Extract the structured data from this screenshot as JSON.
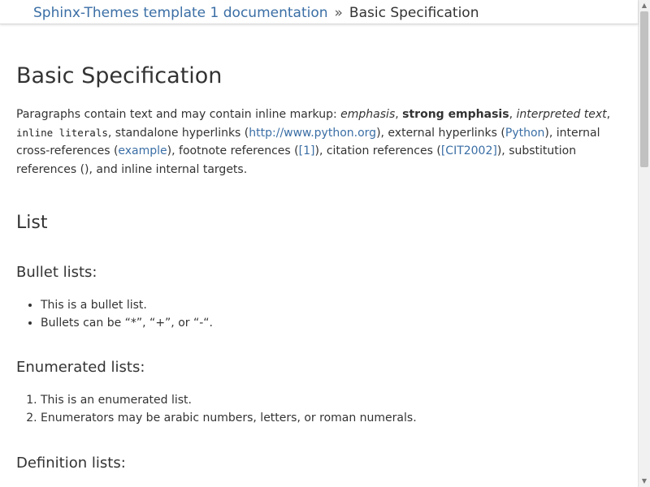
{
  "breadcrumb": {
    "home": "Sphinx-Themes template 1 documentation",
    "separator": "»",
    "current": "Basic Specification"
  },
  "page": {
    "title": "Basic Specification",
    "para": {
      "t1": "Paragraphs contain text and may contain inline markup: ",
      "emphasis": "emphasis",
      "t2": ", ",
      "strong": "strong emphasis",
      "t3": ", ",
      "interpreted": "interpreted text",
      "t4": ", ",
      "literal": "inline literals",
      "t5": ", standalone hyperlinks (",
      "link_url": "http://www.python.org",
      "t6": "), external hyperlinks (",
      "link_python": "Python",
      "t7": "), internal cross-references (",
      "link_example": "example",
      "t8": "), footnote references (",
      "link_footnote": "[1]",
      "t9": "), citation references (",
      "link_citation": "[CIT2002]",
      "t10": "), substitution references (), and inline internal targets."
    },
    "list_heading": "List",
    "bullet": {
      "heading": "Bullet lists:",
      "items": [
        "This is a bullet list.",
        "Bullets can be “*”, “+”, or “-“."
      ]
    },
    "enumerated": {
      "heading": "Enumerated lists:",
      "items": [
        "This is an enumerated list.",
        "Enumerators may be arabic numbers, letters, or roman numerals."
      ]
    },
    "definition": {
      "heading": "Definition lists:"
    }
  },
  "scrollbar": {
    "up_icon": "triangle-up-icon",
    "down_icon": "triangle-down-icon"
  },
  "colors": {
    "link": "#3a6ea5",
    "text": "#333333"
  }
}
